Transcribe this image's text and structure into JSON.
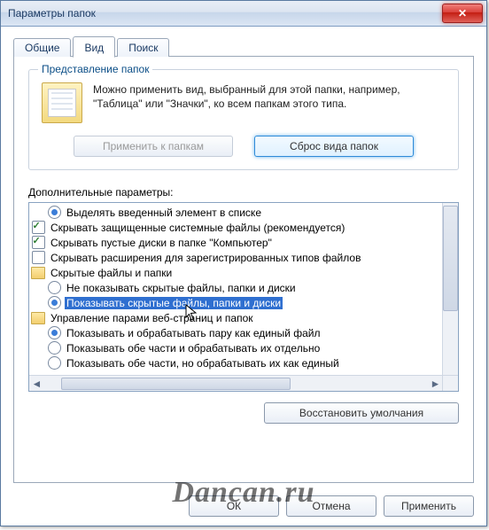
{
  "title": "Параметры папок",
  "close_glyph": "✕",
  "tabs": {
    "general": "Общие",
    "view": "Вид",
    "search": "Поиск"
  },
  "group": {
    "title": "Представление папок",
    "text": "Можно применить вид, выбранный для этой папки, например, \"Таблица\" или \"Значки\", ко всем папкам этого типа.",
    "apply": "Применить к папкам",
    "reset": "Сброс вида папок"
  },
  "adv": {
    "label": "Дополнительные параметры:",
    "items": [
      {
        "kind": "radio",
        "sel": true,
        "indent": 1,
        "text": "Выделять введенный элемент в списке"
      },
      {
        "kind": "check",
        "sel": true,
        "indent": 0,
        "text": "Скрывать защищенные системные файлы (рекомендуется)"
      },
      {
        "kind": "check",
        "sel": true,
        "indent": 0,
        "text": "Скрывать пустые диски в папке \"Компьютер\""
      },
      {
        "kind": "check",
        "sel": false,
        "indent": 0,
        "text": "Скрывать расширения для зарегистрированных типов файлов"
      },
      {
        "kind": "folder",
        "indent": 0,
        "text": "Скрытые файлы и папки"
      },
      {
        "kind": "radio",
        "sel": false,
        "indent": 1,
        "text": "Не показывать скрытые файлы, папки и диски"
      },
      {
        "kind": "radio",
        "sel": true,
        "indent": 1,
        "text": "Показывать скрытые файлы, папки и диски",
        "hl": true
      },
      {
        "kind": "folder",
        "indent": 0,
        "text": "Управление парами веб-страниц и папок"
      },
      {
        "kind": "radio",
        "sel": true,
        "indent": 1,
        "text": "Показывать и обрабатывать пару как единый файл"
      },
      {
        "kind": "radio",
        "sel": false,
        "indent": 1,
        "text": "Показывать обе части и обрабатывать их отдельно"
      },
      {
        "kind": "radio",
        "sel": false,
        "indent": 1,
        "text": "Показывать обе части, но обрабатывать их как единый"
      }
    ]
  },
  "restore": "Восстановить умолчания",
  "ok": "ОК",
  "cancel": "Отмена",
  "apply": "Применить",
  "watermark": "Dancan.ru"
}
